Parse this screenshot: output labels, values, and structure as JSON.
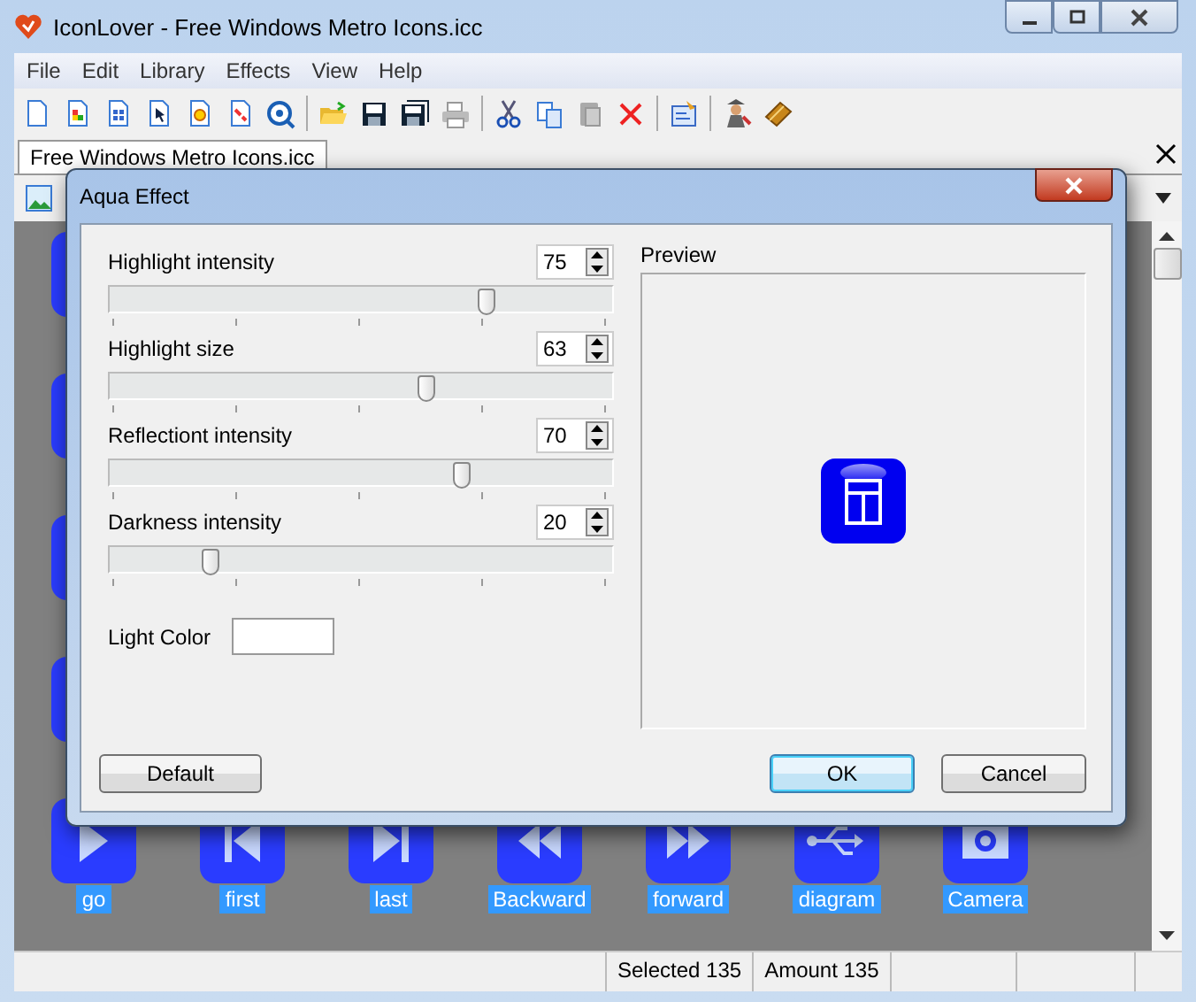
{
  "window": {
    "title": "IconLover - Free Windows Metro Icons.icc"
  },
  "menu": [
    "File",
    "Edit",
    "Library",
    "Effects",
    "View",
    "Help"
  ],
  "tabs": [
    {
      "label": "Free Windows Metro Icons.icc",
      "selected": true
    }
  ],
  "icons": [
    {
      "label": "go"
    },
    {
      "label": "first"
    },
    {
      "label": "last"
    },
    {
      "label": "Backward"
    },
    {
      "label": "forward"
    },
    {
      "label": "diagram"
    },
    {
      "label": "Camera"
    }
  ],
  "status_bar": {
    "panes": [
      "Selected 135",
      "Amount 135"
    ]
  },
  "dialog": {
    "title": "Aqua Effect",
    "settings": [
      {
        "label": "Highlight intensity",
        "value": "75",
        "level": 0.75
      },
      {
        "label": "Highlight size",
        "value": "63",
        "level": 0.63
      },
      {
        "label": "Reflectiont intensity",
        "value": "70",
        "level": 0.7
      },
      {
        "label": "Darkness intensity",
        "value": "20",
        "level": 0.2
      }
    ],
    "light_color": {
      "label": "Light Color",
      "color": "#ffffff"
    },
    "preview": {
      "label": "Preview"
    },
    "buttons": [
      {
        "label": "Default",
        "kind": "left"
      },
      {
        "label": "OK",
        "kind": "default"
      },
      {
        "label": "Cancel",
        "kind": "normal"
      }
    ]
  }
}
